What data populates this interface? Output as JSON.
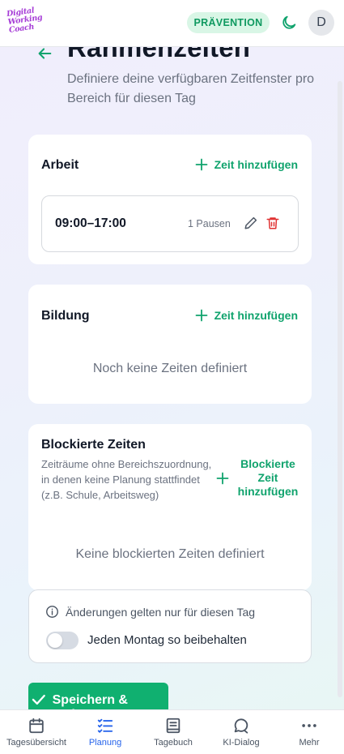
{
  "header": {
    "logo_lines": [
      "Digital",
      "Working",
      "Coach"
    ],
    "badge": "PRÄVENTION",
    "avatar_initial": "D",
    "accent": "#10a36d"
  },
  "page": {
    "title": "Rahmenzeiten",
    "subtitle": "Definiere deine verfügbaren Zeitfenster pro Bereich für diesen Tag"
  },
  "sections": {
    "arbeit": {
      "title": "Arbeit",
      "add_label": "Zeit hinzufügen",
      "slots": [
        {
          "time": "09:00–17:00",
          "pauses": "1 Pausen"
        }
      ]
    },
    "bildung": {
      "title": "Bildung",
      "add_label": "Zeit hinzufügen",
      "empty_text": "Noch keine Zeiten definiert"
    },
    "blockiert": {
      "title": "Blockierte Zeiten",
      "description": "Zeiträume ohne Bereichszuordnung, in denen keine Planung stattfindet (z.B. Schule, Arbeitsweg)",
      "add_label": "Blockierte Zeit hinzufügen",
      "empty_text": "Keine blockierten Zeiten definiert"
    }
  },
  "info": {
    "notice": "Änderungen gelten nur für diesen Tag",
    "toggle_label": "Jeden Montag so beibehalten",
    "toggle_on": false
  },
  "actions": {
    "save_label": "Speichern & Weiter"
  },
  "bottom_nav": [
    {
      "label": "Tagesübersicht",
      "icon": "calendar-icon",
      "active": false
    },
    {
      "label": "Planung",
      "icon": "list-check-icon",
      "active": true
    },
    {
      "label": "Tagebuch",
      "icon": "book-icon",
      "active": false
    },
    {
      "label": "KI-Dialog",
      "icon": "chat-icon",
      "active": false
    },
    {
      "label": "Mehr",
      "icon": "more-icon",
      "active": false
    }
  ]
}
